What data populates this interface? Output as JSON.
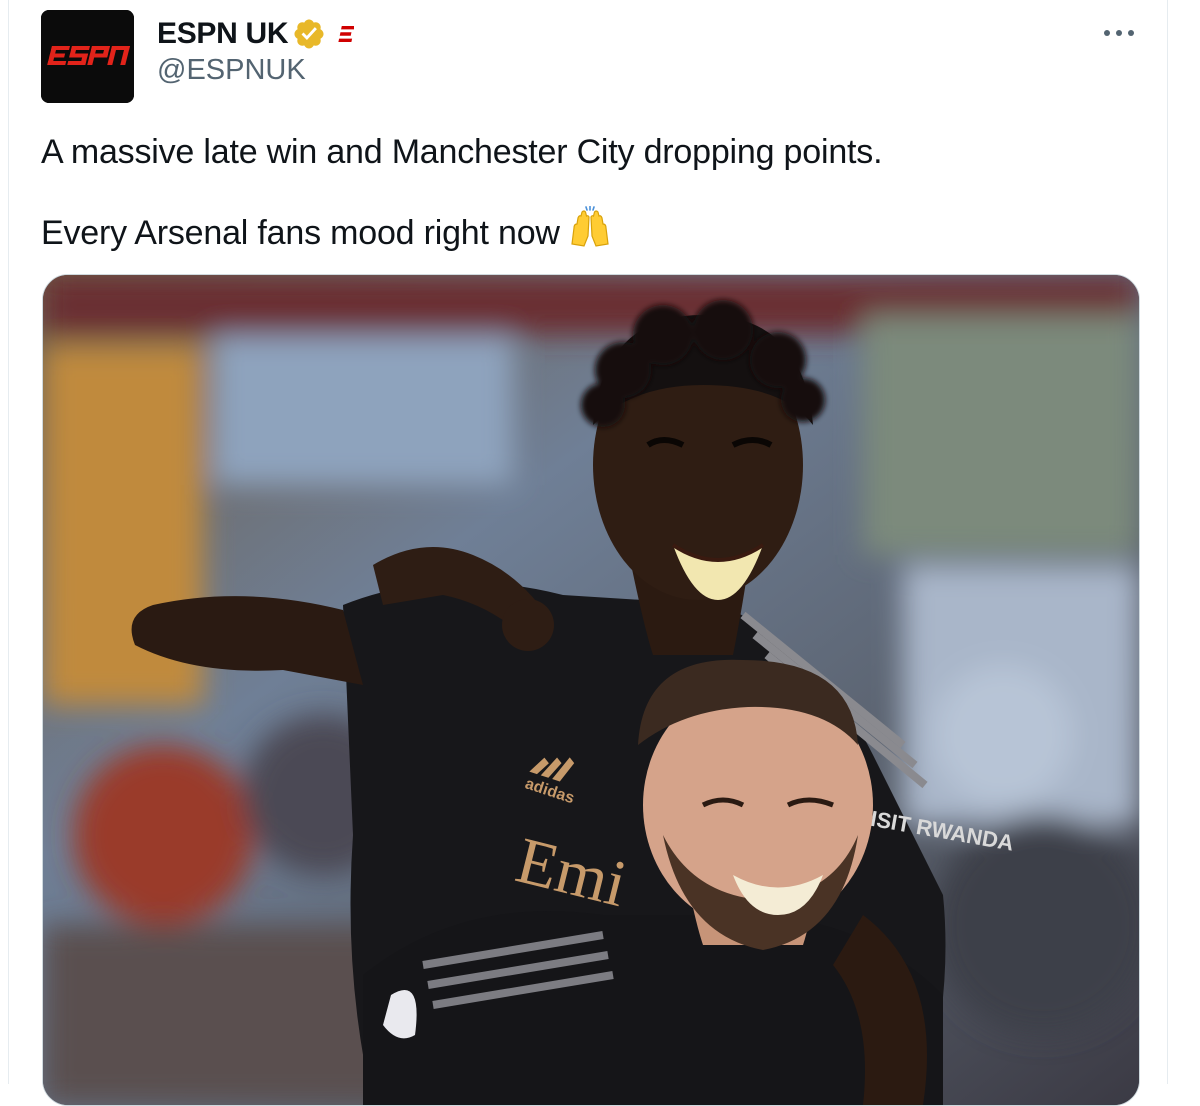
{
  "author": {
    "display_name": "ESPN UK",
    "handle": "@ESPNUK",
    "avatar_logo_text": "ESPN",
    "verified_icon": "gold-verified-badge",
    "affiliate_icon": "espn-e-badge"
  },
  "menu": {
    "more_icon": "more-horizontal-icon",
    "dots": "•••"
  },
  "tweet": {
    "line1": "A massive late win and Manchester City dropping points.",
    "line2": "Every Arsenal fans mood right now"
  },
  "media": {
    "description_icon": "photo",
    "sponsor_text": "Emi",
    "brand_text": "adidas",
    "sleeve_text": "VISIT RWANDA"
  },
  "colors": {
    "badge_gold": "#e8b829",
    "espn_red": "#d00000",
    "handle_gray": "#536471"
  }
}
